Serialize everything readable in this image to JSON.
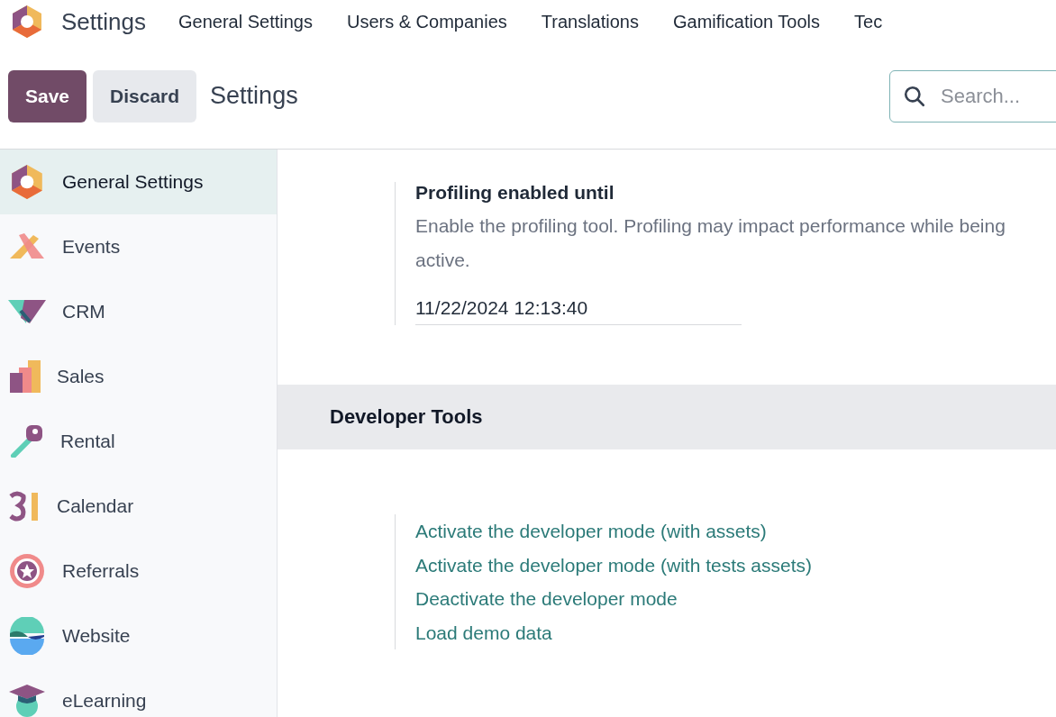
{
  "app": {
    "title": "Settings"
  },
  "menu": [
    "General Settings",
    "Users & Companies",
    "Translations",
    "Gamification Tools",
    "Tec"
  ],
  "control_panel": {
    "save": "Save",
    "discard": "Discard",
    "breadcrumb": "Settings",
    "search": {
      "placeholder": "Search..."
    }
  },
  "sidebar": {
    "items": [
      {
        "label": "General Settings",
        "selected": true
      },
      {
        "label": "Events",
        "selected": false
      },
      {
        "label": "CRM",
        "selected": false
      },
      {
        "label": "Sales",
        "selected": false
      },
      {
        "label": "Rental",
        "selected": false
      },
      {
        "label": "Calendar",
        "selected": false
      },
      {
        "label": "Referrals",
        "selected": false
      },
      {
        "label": "Website",
        "selected": false
      },
      {
        "label": "eLearning",
        "selected": false
      }
    ]
  },
  "profiling": {
    "title": "Profiling enabled until",
    "description": "Enable the profiling tool. Profiling may impact performance while being active.",
    "value": "11/22/2024 12:13:40"
  },
  "developer_tools": {
    "title": "Developer Tools",
    "links": [
      "Activate the developer mode (with assets)",
      "Activate the developer mode (with tests assets)",
      "Deactivate the developer mode",
      "Load demo data"
    ]
  }
}
